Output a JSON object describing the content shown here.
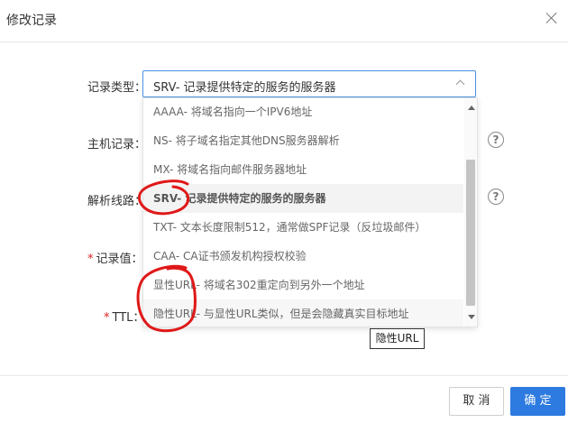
{
  "dialog": {
    "title": "修改记录"
  },
  "form": {
    "record_type_label": "记录类型：",
    "host_label": "主机记录：",
    "line_label": "解析线路：",
    "value_label": "记录值：",
    "ttl_label": "TTL：",
    "required_mark": "*",
    "help_glyph": "?"
  },
  "select": {
    "value": "SRV- 记录提供特定的服务的服务器"
  },
  "dropdown": {
    "options": [
      {
        "label": "AAAA- 将域名指向一个IPV6地址"
      },
      {
        "label": "NS- 将子域名指定其他DNS服务器解析"
      },
      {
        "label": "MX- 将域名指向邮件服务器地址"
      },
      {
        "label": "SRV- 记录提供特定的服务的服务器",
        "selected": true
      },
      {
        "label": "TXT- 文本长度限制512，通常做SPF记录（反垃圾邮件）"
      },
      {
        "label": "CAA- CA证书颁发机构授权校验"
      },
      {
        "label": "显性URL- 将域名302重定向到另外一个地址"
      },
      {
        "label": "隐性URL- 与显性URL类似，但是会隐藏真实目标地址"
      }
    ]
  },
  "tooltip": {
    "text": "隐性URL"
  },
  "footer": {
    "cancel_label": "取 消",
    "ok_label": "确 定"
  },
  "colors": {
    "primary": "#2d7ae0",
    "select_border": "#4a90e2",
    "required": "#e02020",
    "annotation": "#e01818"
  },
  "icons": [
    "close-icon",
    "chevron-up-icon",
    "help-icon"
  ]
}
